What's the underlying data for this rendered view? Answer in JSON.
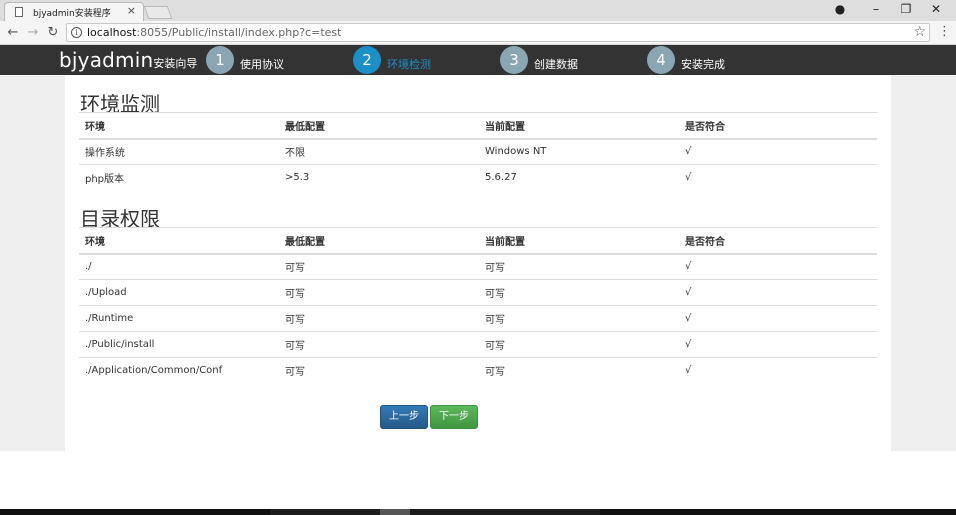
{
  "browser": {
    "tab_title": "bjyadmin安装程序",
    "tab_close": "×",
    "url_host": "localhost",
    "url_rest": ":8055/Public/install/index.php?c=test",
    "info_glyph": "i",
    "star_glyph": "☆",
    "back_glyph": "←",
    "forward_glyph": "→",
    "reload_glyph": "↻",
    "menu_glyph": "⋮",
    "profile_glyph": "●",
    "minimize_glyph": "–",
    "restore_glyph": "❐",
    "close_glyph": "✕"
  },
  "header": {
    "brand_name": "bjyadmin",
    "brand_sub": "安装向导",
    "steps": [
      {
        "num": "1",
        "label": "使用协议",
        "active": false
      },
      {
        "num": "2",
        "label": "环境检测",
        "active": true
      },
      {
        "num": "3",
        "label": "创建数据",
        "active": false
      },
      {
        "num": "4",
        "label": "安装完成",
        "active": false
      }
    ]
  },
  "environment": {
    "title": "环境监测",
    "columns": [
      "环境",
      "最低配置",
      "当前配置",
      "是否符合"
    ],
    "rows": [
      [
        "操作系统",
        "不限",
        "Windows NT",
        "√"
      ],
      [
        "php版本",
        ">5.3",
        "5.6.27",
        "√"
      ]
    ]
  },
  "permissions": {
    "title": "目录权限",
    "columns": [
      "环境",
      "最低配置",
      "当前配置",
      "是否符合"
    ],
    "rows": [
      [
        "./",
        "可写",
        "可写",
        "√"
      ],
      [
        "./Upload",
        "可写",
        "可写",
        "√"
      ],
      [
        "./Runtime",
        "可写",
        "可写",
        "√"
      ],
      [
        "./Public/install",
        "可写",
        "可写",
        "√"
      ],
      [
        "./Application/Common/Conf",
        "可写",
        "可写",
        "√"
      ]
    ]
  },
  "buttons": {
    "prev_label": "上一步",
    "next_label": "下一步"
  },
  "colors": {
    "header_bg": "#333333",
    "step_active": "#1a90c6",
    "step_inactive": "#8aa6b3",
    "btn_prev": "#337ab7",
    "btn_next": "#5cb85c"
  }
}
